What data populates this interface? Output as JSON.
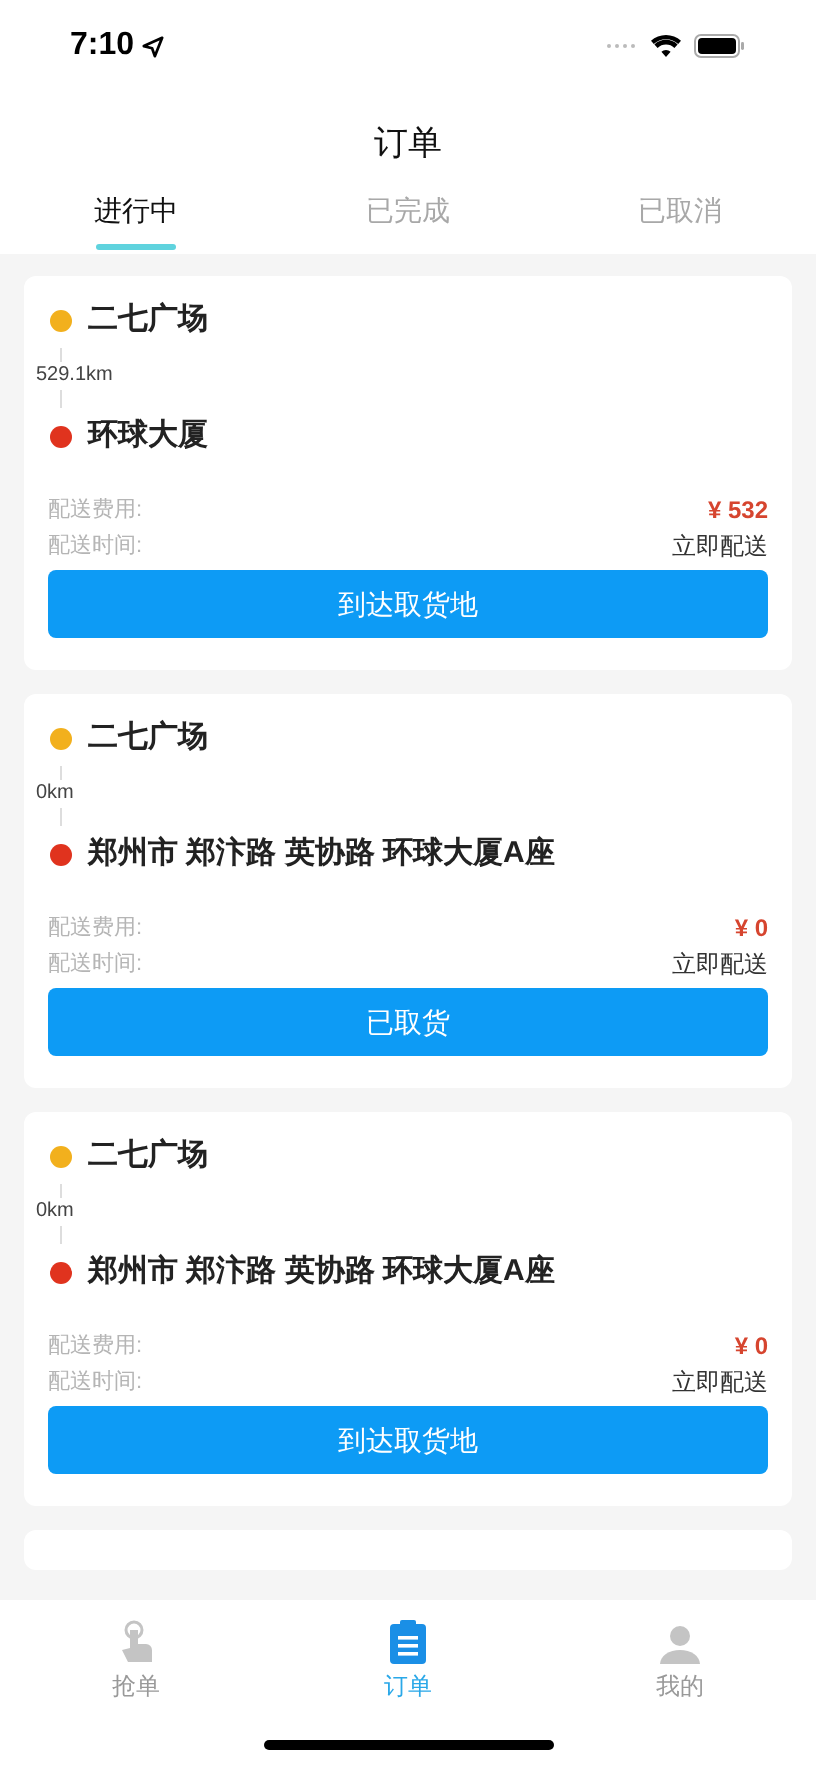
{
  "status_bar": {
    "time": "7:10"
  },
  "header": {
    "title": "订单"
  },
  "tabs": [
    {
      "label": "进行中",
      "selected": true
    },
    {
      "label": "已完成",
      "selected": false
    },
    {
      "label": "已取消",
      "selected": false
    }
  ],
  "orders": [
    {
      "from": "二七广场",
      "distance": "529.1km",
      "to": "环球大厦",
      "fee_label": "配送费用:",
      "fee": "¥ 532",
      "time_label": "配送时间:",
      "time": "立即配送",
      "action": "到达取货地"
    },
    {
      "from": "二七广场",
      "distance": "0km",
      "to": "郑州市 郑汴路 英协路 环球大厦A座",
      "fee_label": "配送费用:",
      "fee": "¥ 0",
      "time_label": "配送时间:",
      "time": "立即配送",
      "action": "已取货"
    },
    {
      "from": "二七广场",
      "distance": "0km",
      "to": "郑州市 郑汴路 英协路 环球大厦A座",
      "fee_label": "配送费用:",
      "fee": "¥ 0",
      "time_label": "配送时间:",
      "time": "立即配送",
      "action": "到达取货地"
    }
  ],
  "tab_bar": [
    {
      "kind": "grab",
      "label": "抢单",
      "selected": false
    },
    {
      "kind": "orders",
      "label": "订单",
      "selected": true
    },
    {
      "kind": "me",
      "label": "我的",
      "selected": false
    }
  ]
}
